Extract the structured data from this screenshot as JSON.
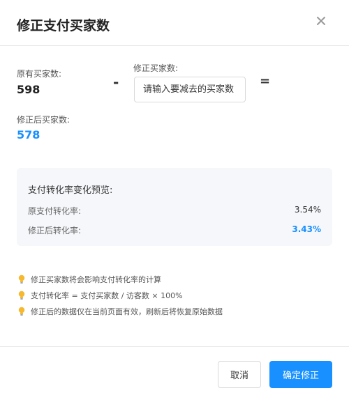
{
  "dialog": {
    "title": "修正支付买家数",
    "close_icon": "close-icon"
  },
  "form": {
    "original_label": "原有买家数:",
    "original_value": "598",
    "minus_sign": "-",
    "edit_label": "修正买家数:",
    "edit_value": "",
    "edit_placeholder": "请输入要减去的买家数",
    "equals_sign": "=",
    "result_label": "修正后买家数:",
    "result_value": "578"
  },
  "preview": {
    "title": "支付转化率变化预览:",
    "rows": [
      {
        "label": "原支付转化率:",
        "value": "3.54%"
      },
      {
        "label": "修正后转化率:",
        "value": "3.43%"
      }
    ]
  },
  "tips": {
    "icon": "lightbulb-icon",
    "items": [
      "修正买家数将会影响支付转化率的计算",
      "支付转化率 = 支付买家数 / 访客数 × 100%",
      "修正后的数据仅在当前页面有效，刷新后将恢复原始数据"
    ]
  },
  "footer": {
    "cancel_label": "取消",
    "confirm_label": "确定修正"
  },
  "colors": {
    "accent": "#1890ff",
    "bulb": "#f5b82e"
  }
}
